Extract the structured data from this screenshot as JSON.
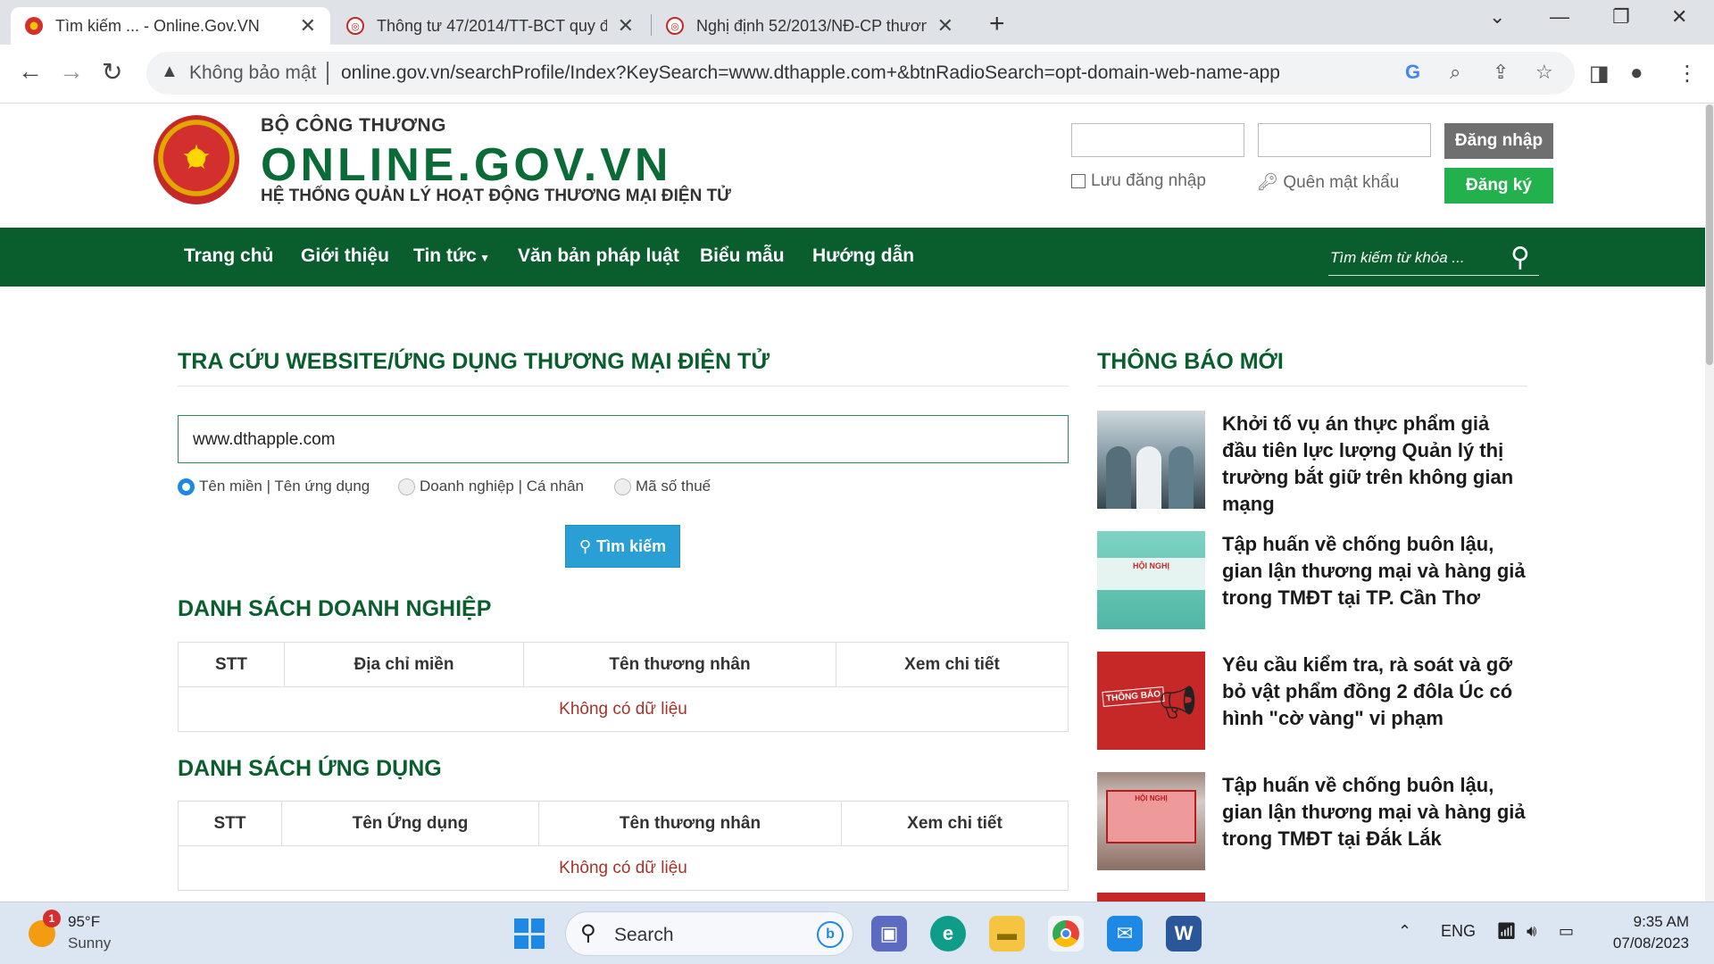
{
  "browser": {
    "tabs": [
      {
        "title": "Tìm kiếm ... - Online.Gov.VN",
        "active": true
      },
      {
        "title": "Thông tư 47/2014/TT-BCT quy đ",
        "active": false
      },
      {
        "title": "Nghị định 52/2013/NĐ-CP thươn",
        "active": false
      }
    ],
    "security_label": "Không bảo mật",
    "url": "online.gov.vn/searchProfile/Index?KeySearch=www.dthapple.com+&btnRadioSearch=opt-domain-web-name-app"
  },
  "header": {
    "ministry": "BỘ CÔNG THƯƠNG",
    "site_name": "ONLINE.GOV.VN",
    "tagline": "HỆ THỐNG QUẢN LÝ HOẠT ĐỘNG THƯƠNG MẠI ĐIỆN TỬ",
    "login_button": "Đăng nhập",
    "register_button": "Đăng ký",
    "remember_label": "Lưu đăng nhập",
    "forgot_label": "Quên mật khẩu"
  },
  "nav": {
    "items": [
      "Trang chủ",
      "Giới thiệu",
      "Tin tức",
      "Văn bản pháp luật",
      "Biểu mẫu",
      "Hướng dẫn"
    ],
    "search_placeholder": "Tìm kiếm từ khóa ..."
  },
  "search": {
    "title": "TRA CỨU WEBSITE/ỨNG DỤNG THƯƠNG MẠI ĐIỆN TỬ",
    "query": "www.dthapple.com",
    "options": [
      {
        "label": "Tên miền | Tên ứng dụng",
        "selected": true
      },
      {
        "label": "Doanh nghiệp | Cá nhân",
        "selected": false
      },
      {
        "label": "Mã số thuế",
        "selected": false
      }
    ],
    "button": "Tìm kiếm"
  },
  "business_list": {
    "title": "DANH SÁCH DOANH NGHIỆP",
    "columns": [
      "STT",
      "Địa chỉ miền",
      "Tên thương nhân",
      "Xem chi tiết"
    ],
    "empty": "Không có dữ liệu"
  },
  "app_list": {
    "title": "DANH SÁCH ỨNG DỤNG",
    "columns": [
      "STT",
      "Tên Ứng dụng",
      "Tên thương nhân",
      "Xem chi tiết"
    ],
    "empty": "Không có dữ liệu"
  },
  "sidebar": {
    "title": "THÔNG BÁO MỚI",
    "news": [
      {
        "title": "Khởi tố vụ án thực phẩm giả đầu tiên lực lượng Quản lý thị trường bắt giữ trên không gian mạng"
      },
      {
        "title": "Tập huấn về chống buôn lậu, gian lận thương mại và hàng giả trong TMĐT tại TP. Cần Thơ",
        "thumb_text": "HỘI NGHỊ"
      },
      {
        "title": "Yêu cầu kiểm tra, rà soát và gỡ bỏ vật phẩm đồng 2 đôla Úc có hình \"cờ vàng\" vi phạm",
        "thumb_text": "THÔNG BÁO"
      },
      {
        "title": "Tập huấn về chống buôn lậu, gian lận thương mại và hàng giả trong TMĐT tại Đắk Lắk",
        "thumb_text": "HỘI NGHỊ"
      }
    ]
  },
  "taskbar": {
    "weather_temp": "95°F",
    "weather_condition": "Sunny",
    "weather_badge": "1",
    "search_label": "Search",
    "language": "ENG",
    "time": "9:35 AM",
    "date": "07/08/2023"
  }
}
